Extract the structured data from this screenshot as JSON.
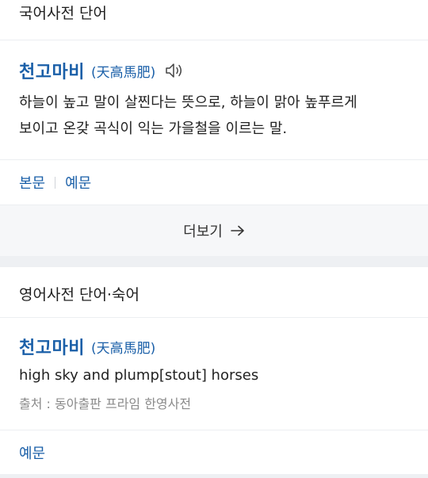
{
  "korean_dict": {
    "title": "국어사전 단어",
    "entry": {
      "headword": "천고마비",
      "hanja": "(天高馬肥)",
      "definition_line1": "하늘이 높고 말이 살찐다는 뜻으로, 하늘이 맑아 높푸르게",
      "definition_line2": "보이고 온갖 곡식이 익는 가을철을 이르는 말."
    },
    "links": [
      "본문",
      "예문"
    ],
    "more_label": "더보기"
  },
  "english_dict": {
    "title": "영어사전 단어·숙어",
    "entry": {
      "headword": "천고마비",
      "hanja": "(天高馬肥)",
      "definition": "high sky and plump[stout] horses",
      "source": "출처 : 동아출판 프라임 한영사전"
    },
    "links": [
      "예문"
    ]
  },
  "colors": {
    "accent": "#1a5fa8",
    "text": "#1e1e1e",
    "muted": "#8a8a8a",
    "background": "#eef0f3"
  },
  "icons": {
    "speaker": "speaker-icon",
    "arrow": "arrow-right-icon"
  }
}
